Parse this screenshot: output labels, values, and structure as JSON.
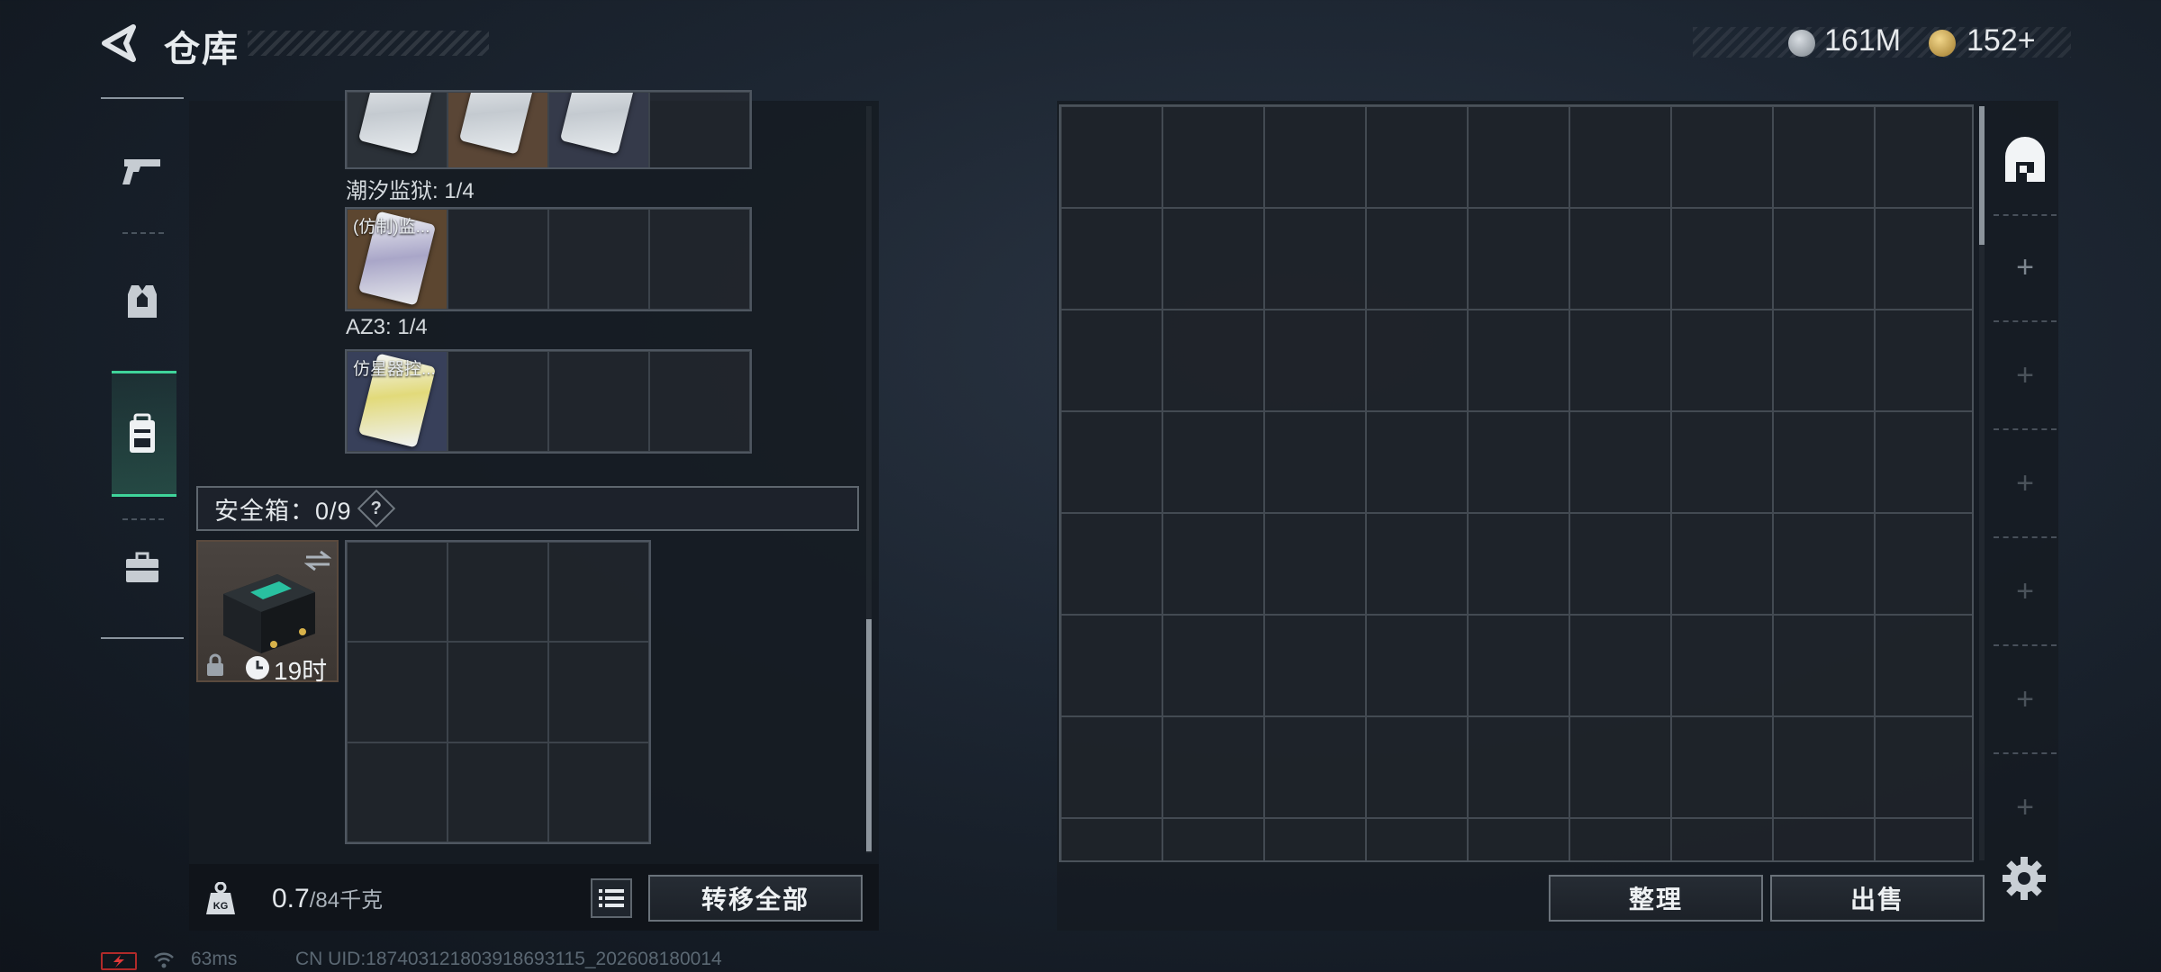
{
  "header": {
    "title": "仓库"
  },
  "currency": [
    {
      "icon": "silver-coin-icon",
      "value": "161M"
    },
    {
      "icon": "gold-coin-icon",
      "value": "152+"
    }
  ],
  "left_nav": [
    {
      "icon": "gun-icon",
      "selected": false
    },
    {
      "icon": "armor-vest-icon",
      "selected": false
    },
    {
      "icon": "backpack-icon",
      "selected": true
    },
    {
      "icon": "briefcase-icon",
      "selected": false
    }
  ],
  "containers": [
    {
      "label": "潮汐监狱: 1/4",
      "item": "(仿制)监..."
    },
    {
      "label": "AZ3: 1/4",
      "item": "仿星器控..."
    }
  ],
  "safe_box": {
    "label": "安全箱：0/9",
    "help": "?",
    "timer": "19时"
  },
  "weight": {
    "current": "0.7",
    "max": "/84千克",
    "icon_label": "KG"
  },
  "buttons": {
    "transfer_all": "转移全部",
    "sort": "整理",
    "sell": "出售"
  },
  "status_bar": {
    "ping": "63ms",
    "uid": "CN UID:1874031218039186931​15_202608180014"
  },
  "colors": {
    "accent": "#3fd49a",
    "battery": "#b02a2a"
  }
}
